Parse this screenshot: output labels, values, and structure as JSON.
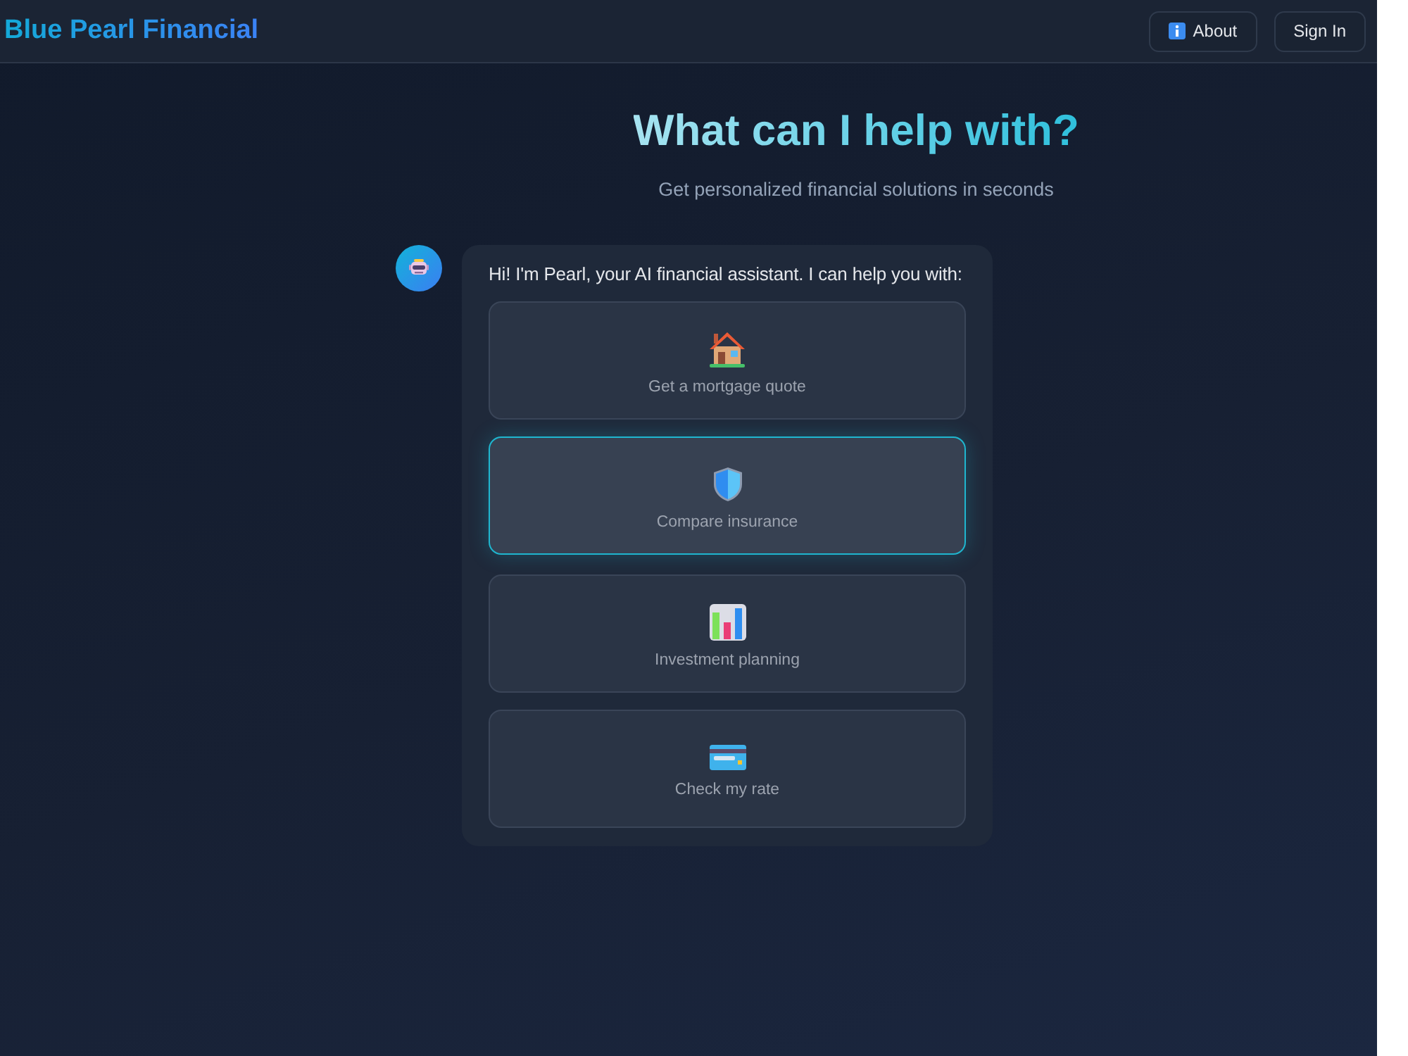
{
  "header": {
    "logo": "Blue Pearl Financial",
    "buttons": [
      {
        "label": "About",
        "kind": "info"
      },
      {
        "label": "Sign In",
        "kind": "plain"
      }
    ]
  },
  "hero": {
    "title": "What can I help with?",
    "subtitle": "Get personalized financial solutions in seconds"
  },
  "chat": {
    "message": "Hi! I'm Pearl, your AI financial assistant. I can help you with:",
    "options": [
      {
        "label": "Get a mortgage quote",
        "kind": "house",
        "selected": false
      },
      {
        "label": "Compare insurance",
        "kind": "shield",
        "selected": true
      },
      {
        "label": "Investment planning",
        "kind": "chart",
        "selected": false
      },
      {
        "label": "Check my rate",
        "kind": "card",
        "selected": false
      }
    ]
  }
}
